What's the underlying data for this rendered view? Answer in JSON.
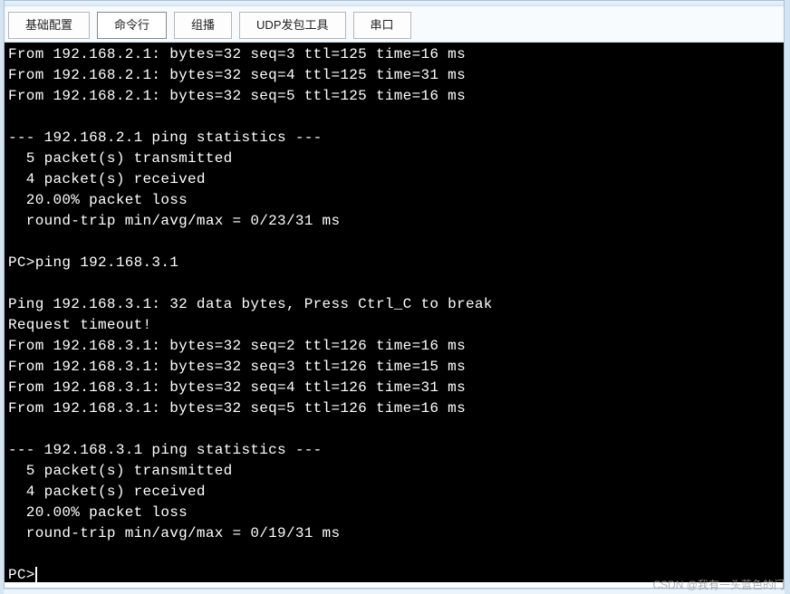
{
  "tabs": {
    "basic": "基础配置",
    "cmd": "命令行",
    "multicast": "组播",
    "udp": "UDP发包工具",
    "serial": "串口"
  },
  "terminal": {
    "lines": [
      "From 192.168.2.1: bytes=32 seq=3 ttl=125 time=16 ms",
      "From 192.168.2.1: bytes=32 seq=4 ttl=125 time=31 ms",
      "From 192.168.2.1: bytes=32 seq=5 ttl=125 time=16 ms",
      "",
      "--- 192.168.2.1 ping statistics ---",
      "  5 packet(s) transmitted",
      "  4 packet(s) received",
      "  20.00% packet loss",
      "  round-trip min/avg/max = 0/23/31 ms",
      "",
      "PC>ping 192.168.3.1",
      "",
      "Ping 192.168.3.1: 32 data bytes, Press Ctrl_C to break",
      "Request timeout!",
      "From 192.168.3.1: bytes=32 seq=2 ttl=126 time=16 ms",
      "From 192.168.3.1: bytes=32 seq=3 ttl=126 time=15 ms",
      "From 192.168.3.1: bytes=32 seq=4 ttl=126 time=31 ms",
      "From 192.168.3.1: bytes=32 seq=5 ttl=126 time=16 ms",
      "",
      "--- 192.168.3.1 ping statistics ---",
      "  5 packet(s) transmitted",
      "  4 packet(s) received",
      "  20.00% packet loss",
      "  round-trip min/avg/max = 0/19/31 ms",
      ""
    ],
    "prompt": "PC>"
  },
  "watermark": "CSDN @我有一头蓝色的门"
}
